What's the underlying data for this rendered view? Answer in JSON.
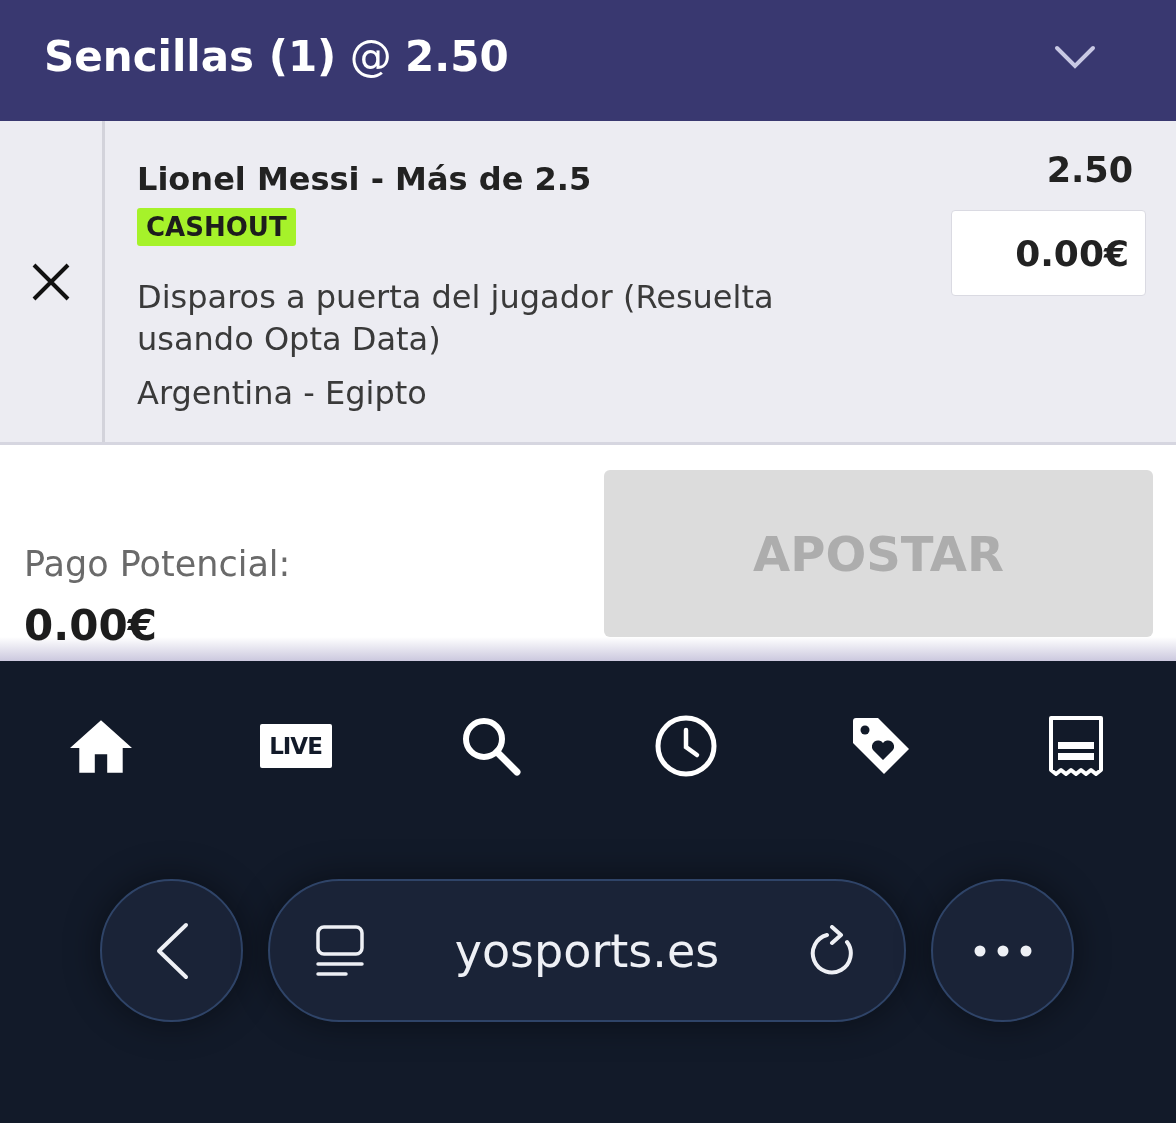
{
  "header": {
    "title": "**Sencillas (1)** @ **2.50**"
  },
  "selections": [
    {
      "title": "Lionel Messi - Más de 2.5",
      "badge": "CASHOUT",
      "market": "Disparos a puerta del jugador (Resuelta usando Opta Data)",
      "event": "Argentina - Egipto",
      "odds": "2.50",
      "stake": {
        "value": "0.00€"
      }
    }
  ],
  "summary": {
    "label": "Pago Potencial:",
    "amount": "0.00€"
  },
  "bet_button": {
    "label": "APOSTAR",
    "disabled": true
  },
  "bottom_nav": {
    "live_label": "LIVE"
  },
  "browser_bar": {
    "url": "yosports.es"
  }
}
